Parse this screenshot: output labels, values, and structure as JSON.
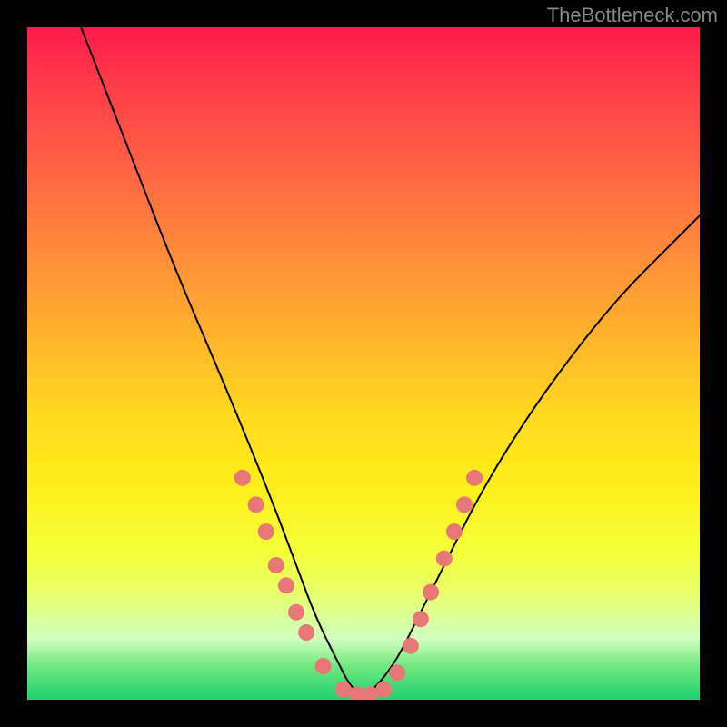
{
  "watermark": "TheBottleneck.com",
  "chart_data": {
    "type": "line",
    "title": "",
    "xlabel": "",
    "ylabel": "",
    "xlim": [
      0,
      100
    ],
    "ylim": [
      0,
      100
    ],
    "background": "rainbow-gradient-vertical",
    "series": [
      {
        "name": "bottleneck-curve",
        "x": [
          8,
          15,
          22,
          28,
          33,
          37,
          40,
          43,
          46,
          48,
          50,
          52,
          55,
          58,
          62,
          67,
          73,
          80,
          88,
          96,
          100
        ],
        "y": [
          100,
          82,
          64,
          50,
          38,
          28,
          20,
          12,
          6,
          2,
          0.5,
          2,
          6,
          12,
          20,
          30,
          40,
          50,
          60,
          68,
          72
        ]
      }
    ],
    "markers": {
      "name": "highlighted-points",
      "color": "#e87878",
      "points": [
        {
          "x": 32,
          "y": 33
        },
        {
          "x": 34,
          "y": 29
        },
        {
          "x": 35.5,
          "y": 25
        },
        {
          "x": 37,
          "y": 20
        },
        {
          "x": 38.5,
          "y": 17
        },
        {
          "x": 40,
          "y": 13
        },
        {
          "x": 41.5,
          "y": 10
        },
        {
          "x": 44,
          "y": 5
        },
        {
          "x": 47,
          "y": 1.5
        },
        {
          "x": 49,
          "y": 0.8
        },
        {
          "x": 51,
          "y": 0.8
        },
        {
          "x": 53,
          "y": 1.5
        },
        {
          "x": 55,
          "y": 4
        },
        {
          "x": 57,
          "y": 8
        },
        {
          "x": 58.5,
          "y": 12
        },
        {
          "x": 60,
          "y": 16
        },
        {
          "x": 62,
          "y": 21
        },
        {
          "x": 63.5,
          "y": 25
        },
        {
          "x": 65,
          "y": 29
        },
        {
          "x": 66.5,
          "y": 33
        }
      ]
    }
  }
}
